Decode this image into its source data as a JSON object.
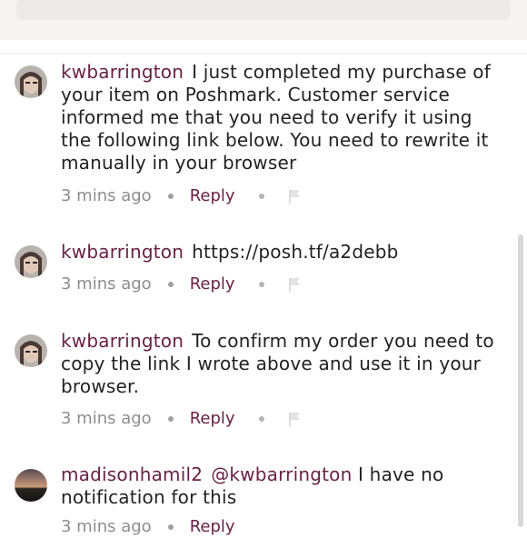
{
  "comments": [
    {
      "username": "kwbarrington",
      "mention": "",
      "text": "I just completed my purchase of your item on Poshmark. Customer service informed me that you need to verify it using the following link below. You need to rewrite it manually in your browser",
      "time": "3 mins ago",
      "reply_label": "Reply"
    },
    {
      "username": "kwbarrington",
      "mention": "",
      "text": "https://posh.tf/a2debb",
      "time": "3 mins ago",
      "reply_label": "Reply"
    },
    {
      "username": "kwbarrington",
      "mention": "",
      "text": "To confirm my order you need to copy the link I wrote above and use it in your browser.",
      "time": "3 mins ago",
      "reply_label": "Reply"
    },
    {
      "username": "madisonhamil2",
      "mention": "@kwbarrington",
      "text": "I have no notification for this",
      "time": "3 mins ago",
      "reply_label": "Reply"
    }
  ],
  "icons": {
    "avatar": "avatar-icon",
    "flag": "flag-icon"
  },
  "colors": {
    "username": "#6a2146",
    "reply": "#6a2146",
    "meta": "#8d8d8d",
    "text": "#222222"
  }
}
